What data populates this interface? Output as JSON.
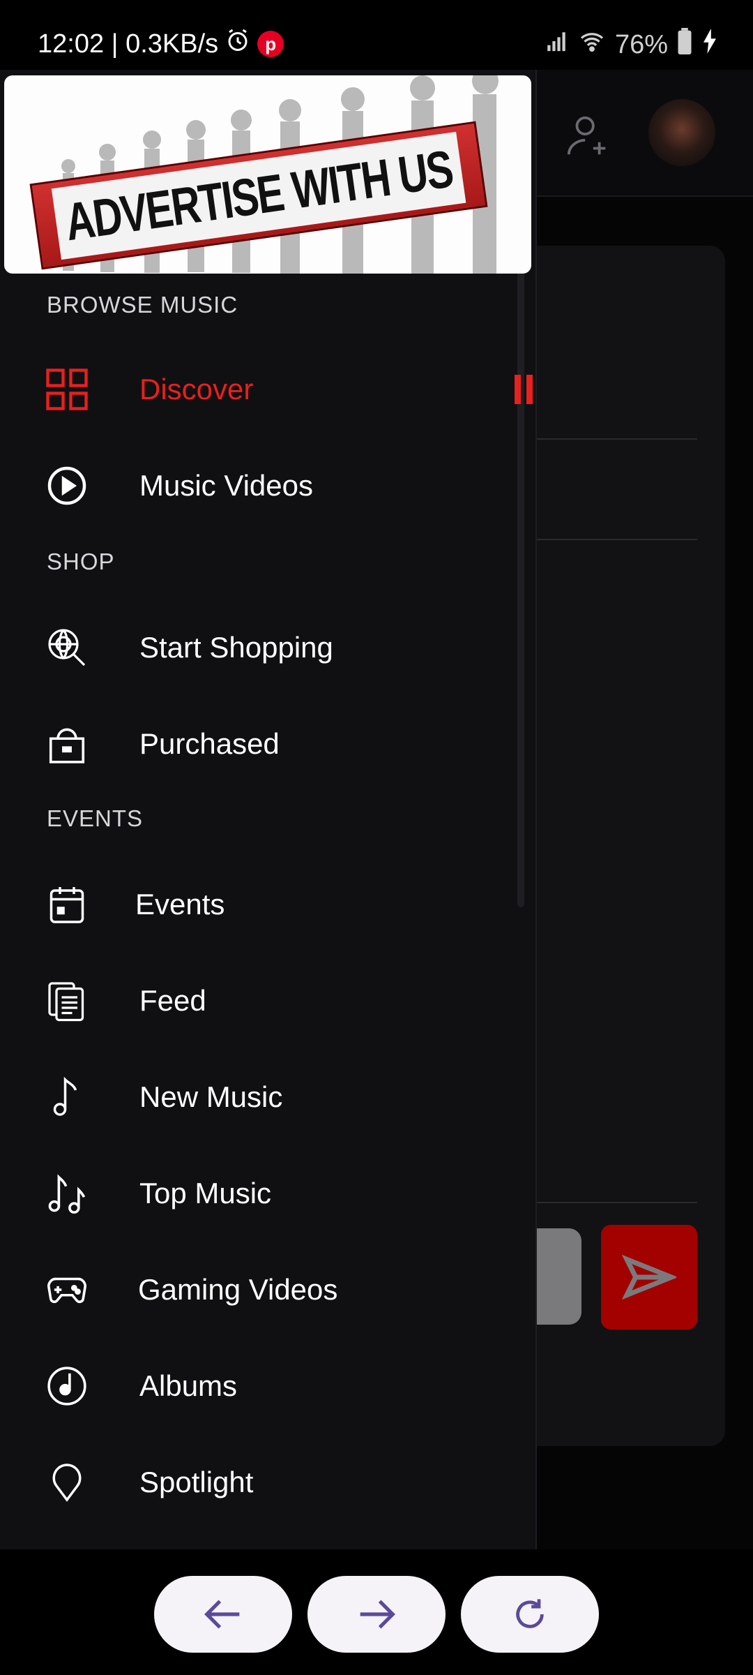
{
  "status": {
    "time_speed": "12:02 | 0.3KB/s",
    "battery": "76%",
    "notification_icon": "pinterest-icon"
  },
  "ad": {
    "text": "ADVERTISE WITH US"
  },
  "sections": {
    "browse": "BROWSE MUSIC",
    "shop": "SHOP",
    "events": "EVENTS"
  },
  "menu": {
    "discover": "Discover",
    "music_videos": "Music Videos",
    "start_shopping": "Start Shopping",
    "purchased": "Purchased",
    "events": "Events",
    "feed": "Feed",
    "new_music": "New Music",
    "top_music": "Top Music",
    "gaming_videos": "Gaming Videos",
    "albums": "Albums",
    "spotlight": "Spotlight"
  },
  "colors": {
    "accent": "#e8201e",
    "drawer_bg": "#101013",
    "nav_button_bg": "#f5f3f7",
    "nav_icon": "#5b4a9a"
  }
}
